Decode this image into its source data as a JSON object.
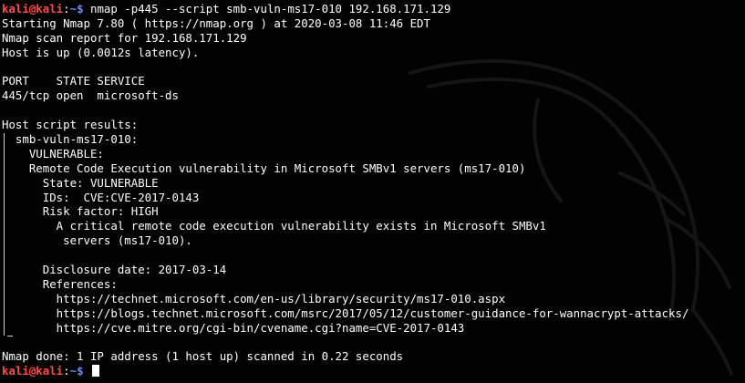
{
  "prompt": {
    "user": "kali@kali",
    "separator": ":",
    "path": "~$",
    "command": " nmap -p445 --script smb-vuln-ms17-010 192.168.171.129"
  },
  "output": {
    "l1": "Starting Nmap 7.80 ( https://nmap.org ) at 2020-03-08 11:46 EDT",
    "l2": "Nmap scan report for 192.168.171.129",
    "l3": "Host is up (0.0012s latency).",
    "l4": "",
    "l5": "PORT    STATE SERVICE",
    "l6": "445/tcp open  microsoft-ds",
    "l7": "",
    "l8": "Host script results:",
    "l9": "  smb-vuln-ms17-010:",
    "l10": "    VULNERABLE:",
    "l11": "    Remote Code Execution vulnerability in Microsoft SMBv1 servers (ms17-010)",
    "l12": "      State: VULNERABLE",
    "l13": "      IDs:  CVE:CVE-2017-0143",
    "l14": "      Risk factor: HIGH",
    "l15": "        A critical remote code execution vulnerability exists in Microsoft SMBv1",
    "l16": "         servers (ms17-010).",
    "l17": "",
    "l18": "      Disclosure date: 2017-03-14",
    "l19": "      References:",
    "l20": "        https://technet.microsoft.com/en-us/library/security/ms17-010.aspx",
    "l21": "        https://blogs.technet.microsoft.com/msrc/2017/05/12/customer-guidance-for-wannacrypt-attacks/",
    "l22": "        https://cve.mitre.org/cgi-bin/cvename.cgi?name=CVE-2017-0143",
    "l23": "",
    "l24": "Nmap done: 1 IP address (1 host up) scanned in 0.22 seconds"
  },
  "prompt2": {
    "user": "kali@kali",
    "separator": ":",
    "path": "~$",
    "command": " "
  },
  "colors": {
    "background": "#020202",
    "prompt_user": "#ff4b4b",
    "prompt_path": "#6a8cff",
    "text": "#ffffff"
  }
}
